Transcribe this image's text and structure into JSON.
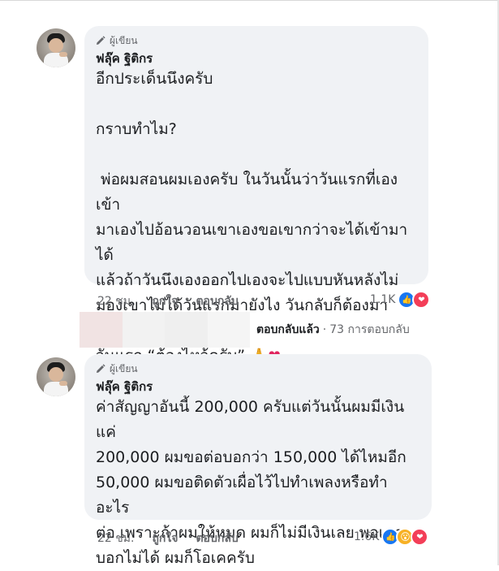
{
  "comments": [
    {
      "badge": "ผู้เขียน",
      "author": "ฟลุ๊ค ฐิติกร",
      "lines": [
        "อีกประเด็นนึงครับ",
        "",
        "กราบทำไม?",
        "",
        " พ่อผมสอนผมเองครับ ในวันนั้นว่าวันแรกที่เองเข้า",
        "มาเองไปอ้อนวอนเขาเองขอเขากว่าจะได้เข้ามาได้",
        "แล้วถ้าวันนึงเองออกไปเองจะไปแบบหันหลังไม่",
        "มองเขาไม่ได้วันแรกมายังไง วันกลับก็ต้องมาแบบ",
        "วันแรก “ต้องไหว้ครับ”"
      ],
      "emojis": [
        "🙏",
        "❤"
      ],
      "time": "22 ชม.",
      "like_label": "ถูกใจ",
      "reply_label": "ตอบกลับ",
      "reaction_count": "1.1K",
      "reactions": [
        "like-icon",
        "love-icon"
      ]
    },
    {
      "badge": "ผู้เขียน",
      "author": "ฟลุ๊ค ฐิติกร",
      "lines": [
        "ค่าสัญญาอันนี้ 200,000 ครับแต่วันนั้นผมมีเงินแค่",
        "200,000 ผมขอต่อบอกว่า 150,000 ได้ไหมอีก",
        "50,000 ผมขอติดตัวเผื่อไว้ไปทำเพลงหรือทำอะไร",
        "ต่อ เพราะถ้าผมให้หมด ผมก็ไม่มีเงินเลย พอเขา",
        "บอกไม่ได้ ผมก็โอเคครับ"
      ],
      "time": "22 ชม.",
      "like_label": "ถูกใจ",
      "reply_label": "ตอบกลับ",
      "reaction_count": "1.6K",
      "reactions": [
        "like-icon",
        "wow-icon",
        "love-icon"
      ]
    }
  ],
  "replies": {
    "replied_label": "ตอบกลับแล้ว",
    "separator": "·",
    "count_label": "73 การตอบกลับ"
  },
  "colors": {
    "bubble": "#f0f2f5",
    "like": "#1877f2",
    "love": "#f33e58",
    "wow": "#f7b125",
    "meta": "#65676b"
  }
}
